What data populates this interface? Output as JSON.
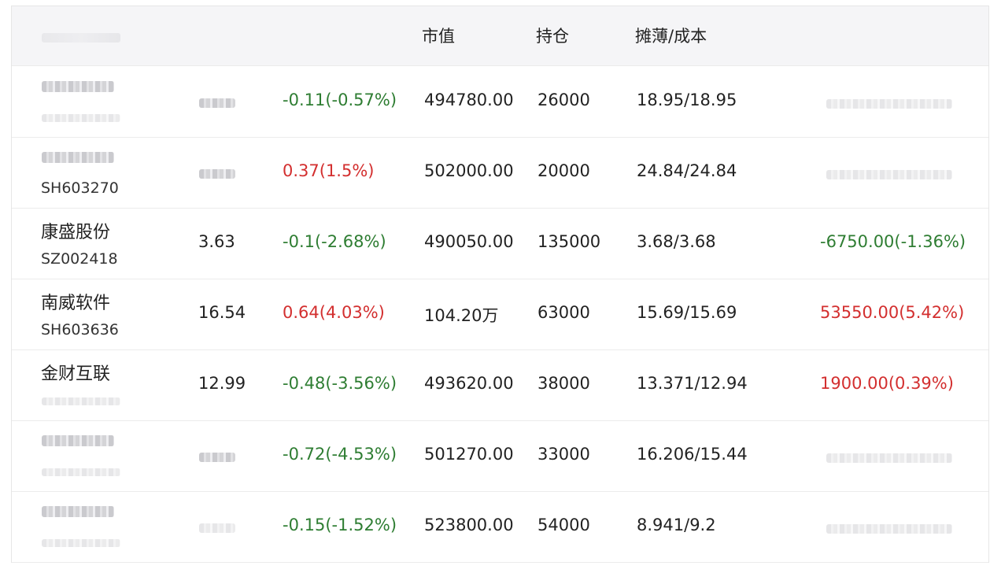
{
  "header": {
    "market_value": "市值",
    "position": "持仓",
    "cost": "摊薄/成本"
  },
  "rows": [
    {
      "name": "",
      "code": "",
      "price": "",
      "change": "-0.11(-0.57%)",
      "change_dir": "down",
      "market_value": "494780.00",
      "position": "26000",
      "cost": "18.95/18.95",
      "pl": "",
      "pl_dir": ""
    },
    {
      "name": "",
      "code": "SH603270",
      "price": "",
      "change": "0.37(1.5%)",
      "change_dir": "up",
      "market_value": "502000.00",
      "position": "20000",
      "cost": "24.84/24.84",
      "pl": "",
      "pl_dir": ""
    },
    {
      "name": "康盛股份",
      "code": "SZ002418",
      "price": "3.63",
      "change": "-0.1(-2.68%)",
      "change_dir": "down",
      "market_value": "490050.00",
      "position": "135000",
      "cost": "3.68/3.68",
      "pl": "-6750.00(-1.36%)",
      "pl_dir": "down"
    },
    {
      "name": "南威软件",
      "code": "SH603636",
      "price": "16.54",
      "change": "0.64(4.03%)",
      "change_dir": "up",
      "market_value": "104.20万",
      "position": "63000",
      "cost": "15.69/15.69",
      "pl": "53550.00(5.42%)",
      "pl_dir": "up"
    },
    {
      "name": "金财互联",
      "code": "",
      "price": "12.99",
      "change": "-0.48(-3.56%)",
      "change_dir": "down",
      "market_value": "493620.00",
      "position": "38000",
      "cost": "13.371/12.94",
      "pl": "1900.00(0.39%)",
      "pl_dir": "up"
    },
    {
      "name": "",
      "code": "",
      "price": "",
      "change": "-0.72(-4.53%)",
      "change_dir": "down",
      "market_value": "501270.00",
      "position": "33000",
      "cost": "16.206/15.44",
      "pl": "",
      "pl_dir": ""
    },
    {
      "name": "",
      "code": "",
      "price": "",
      "change": "-0.15(-1.52%)",
      "change_dir": "down",
      "market_value": "523800.00",
      "position": "54000",
      "cost": "8.941/9.2",
      "pl": "",
      "pl_dir": ""
    }
  ]
}
